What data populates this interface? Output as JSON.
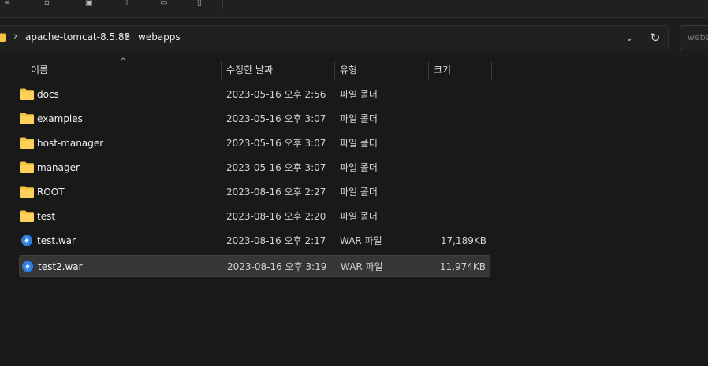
{
  "breadcrumb": {
    "items": [
      "apache-tomcat-8.5.88",
      "webapps"
    ]
  },
  "search": {
    "placeholder": "weba"
  },
  "columns": {
    "name": "이름",
    "date": "수정한 날짜",
    "type": "유형",
    "size": "크기"
  },
  "rows": [
    {
      "name": "docs",
      "date": "2023-05-16 오후 2:56",
      "type": "파일 폴더",
      "size": "",
      "icon": "folder-icon"
    },
    {
      "name": "examples",
      "date": "2023-05-16 오후 3:07",
      "type": "파일 폴더",
      "size": "",
      "icon": "folder-icon"
    },
    {
      "name": "host-manager",
      "date": "2023-05-16 오후 3:07",
      "type": "파일 폴더",
      "size": "",
      "icon": "folder-icon"
    },
    {
      "name": "manager",
      "date": "2023-05-16 오후 3:07",
      "type": "파일 폴더",
      "size": "",
      "icon": "folder-icon"
    },
    {
      "name": "ROOT",
      "date": "2023-08-16 오후 2:27",
      "type": "파일 폴더",
      "size": "",
      "icon": "folder-icon"
    },
    {
      "name": "test",
      "date": "2023-08-16 오후 2:20",
      "type": "파일 폴더",
      "size": "",
      "icon": "folder-icon"
    },
    {
      "name": "test.war",
      "date": "2023-08-16 오후 2:17",
      "type": "WAR 파일",
      "size": "17,189KB",
      "icon": "war-file-icon"
    },
    {
      "name": "test2.war",
      "date": "2023-08-16 오후 3:19",
      "type": "WAR 파일",
      "size": "11,974KB",
      "icon": "war-file-icon",
      "selected": true
    }
  ],
  "colors": {
    "background": "#191919",
    "folder": "#f5c342",
    "war_icon": "#2f7de1",
    "selected_row": "#363636"
  }
}
